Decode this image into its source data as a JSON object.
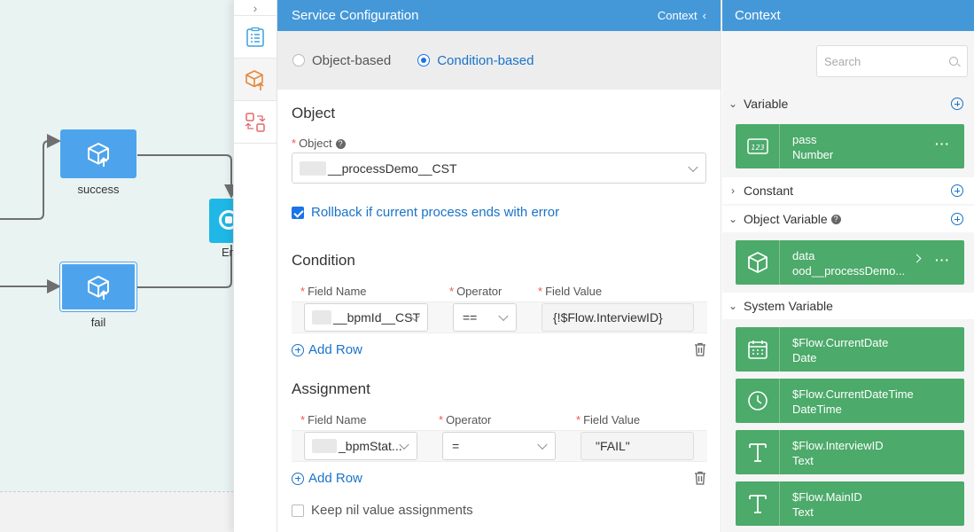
{
  "canvas": {
    "nodes": [
      {
        "label": "success"
      },
      {
        "label": "fail"
      }
    ],
    "end_label": "Er"
  },
  "toolstrip": {
    "collapse_glyph": "›"
  },
  "config": {
    "title": "Service Configuration",
    "context_label": "Context",
    "context_glyph": "‹",
    "modes": {
      "object_based": "Object-based",
      "condition_based": "Condition-based",
      "selected": "condition_based"
    },
    "object": {
      "section_title": "Object",
      "field_label": "Object",
      "value": "__processDemo__CST",
      "rollback_label": "Rollback if current process ends with error",
      "rollback_checked": true
    },
    "condition": {
      "section_title": "Condition",
      "headers": {
        "field_name": "Field Name",
        "operator": "Operator",
        "field_value": "Field Value"
      },
      "rows": [
        {
          "field_name": "__bpmId__CST",
          "operator": "==",
          "field_value": "{!$Flow.InterviewID}"
        }
      ],
      "add_row": "Add Row"
    },
    "assignment": {
      "section_title": "Assignment",
      "headers": {
        "field_name": "Field Name",
        "operator": "Operator",
        "field_value": "Field Value"
      },
      "rows": [
        {
          "field_name": "_bpmStat...",
          "operator": "=",
          "field_value": "\"FAIL\""
        }
      ],
      "add_row": "Add Row"
    },
    "keep_nil_label": "Keep nil value assignments",
    "keep_nil_checked": false
  },
  "context": {
    "title": "Context",
    "search_placeholder": "Search",
    "groups": {
      "variable": "Variable",
      "constant": "Constant",
      "object_variable": "Object Variable",
      "system_variable": "System Variable"
    },
    "variables": [
      {
        "name": "pass",
        "type": "Number",
        "icon": "number-123-icon"
      }
    ],
    "object_variables": [
      {
        "name": "data",
        "type": "ood__processDemo...",
        "icon": "cube-icon"
      }
    ],
    "system_variables": [
      {
        "name": "$Flow.CurrentDate",
        "type": "Date",
        "icon": "calendar-icon"
      },
      {
        "name": "$Flow.CurrentDateTime",
        "type": "DateTime",
        "icon": "clock-icon"
      },
      {
        "name": "$Flow.InterviewID",
        "type": "Text",
        "icon": "text-T-icon"
      },
      {
        "name": "$Flow.MainID",
        "type": "Text",
        "icon": "text-T-icon"
      }
    ],
    "colors": {
      "header": "#4598d8",
      "card": "#4caa6a",
      "accent": "#1a73e8"
    }
  }
}
